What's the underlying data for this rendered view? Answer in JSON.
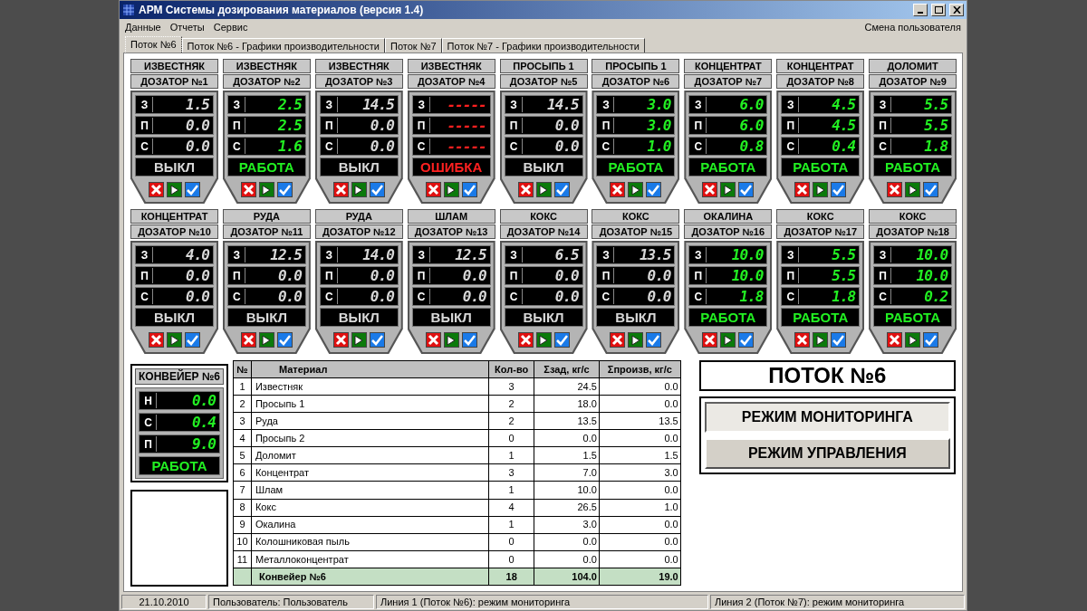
{
  "window": {
    "title": "АРМ Системы дозирования материалов (версия 1.4)"
  },
  "menu": [
    "Данные",
    "Отчеты",
    "Сервис"
  ],
  "user_switch": "Смена пользователя",
  "tabs": [
    {
      "label": "Поток №6",
      "selected": true
    },
    {
      "label": "Поток №6 - Графики производительности",
      "selected": false
    },
    {
      "label": "Поток №7",
      "selected": false
    },
    {
      "label": "Поток №7 - Графики производительности",
      "selected": false
    }
  ],
  "dosers": [
    {
      "material": "ИЗВЕСТНЯК",
      "title": "ДОЗАТОР №1",
      "readings": [
        {
          "label": "З",
          "value": "1.5"
        },
        {
          "label": "П",
          "value": "0.0"
        },
        {
          "label": "С",
          "value": "0.0"
        }
      ],
      "status": {
        "kind": "off",
        "text": "ВЫКЛ"
      }
    },
    {
      "material": "ИЗВЕСТНЯК",
      "title": "ДОЗАТОР №2",
      "readings": [
        {
          "label": "З",
          "value": "2.5"
        },
        {
          "label": "П",
          "value": "2.5"
        },
        {
          "label": "С",
          "value": "1.6"
        }
      ],
      "status": {
        "kind": "run",
        "text": "РАБОТА"
      }
    },
    {
      "material": "ИЗВЕСТНЯК",
      "title": "ДОЗАТОР №3",
      "readings": [
        {
          "label": "З",
          "value": "14.5"
        },
        {
          "label": "П",
          "value": "0.0"
        },
        {
          "label": "С",
          "value": "0.0"
        }
      ],
      "status": {
        "kind": "off",
        "text": "ВЫКЛ"
      }
    },
    {
      "material": "ИЗВЕСТНЯК",
      "title": "ДОЗАТОР №4",
      "readings": [
        {
          "label": "З",
          "value": "-----"
        },
        {
          "label": "П",
          "value": "-----"
        },
        {
          "label": "С",
          "value": "-----"
        }
      ],
      "status": {
        "kind": "error",
        "text": "ОШИБКА"
      }
    },
    {
      "material": "ПРОСЫПЬ 1",
      "title": "ДОЗАТОР №5",
      "readings": [
        {
          "label": "З",
          "value": "14.5"
        },
        {
          "label": "П",
          "value": "0.0"
        },
        {
          "label": "С",
          "value": "0.0"
        }
      ],
      "status": {
        "kind": "off",
        "text": "ВЫКЛ"
      }
    },
    {
      "material": "ПРОСЫПЬ 1",
      "title": "ДОЗАТОР №6",
      "readings": [
        {
          "label": "З",
          "value": "3.0"
        },
        {
          "label": "П",
          "value": "3.0"
        },
        {
          "label": "С",
          "value": "1.0"
        }
      ],
      "status": {
        "kind": "run",
        "text": "РАБОТА"
      }
    },
    {
      "material": "КОНЦЕНТРАТ",
      "title": "ДОЗАТОР №7",
      "readings": [
        {
          "label": "З",
          "value": "6.0"
        },
        {
          "label": "П",
          "value": "6.0"
        },
        {
          "label": "С",
          "value": "0.8"
        }
      ],
      "status": {
        "kind": "run",
        "text": "РАБОТА"
      }
    },
    {
      "material": "КОНЦЕНТРАТ",
      "title": "ДОЗАТОР №8",
      "readings": [
        {
          "label": "З",
          "value": "4.5"
        },
        {
          "label": "П",
          "value": "4.5"
        },
        {
          "label": "С",
          "value": "0.4"
        }
      ],
      "status": {
        "kind": "run",
        "text": "РАБОТА"
      }
    },
    {
      "material": "ДОЛОМИТ",
      "title": "ДОЗАТОР №9",
      "readings": [
        {
          "label": "З",
          "value": "5.5"
        },
        {
          "label": "П",
          "value": "5.5"
        },
        {
          "label": "С",
          "value": "1.8"
        }
      ],
      "status": {
        "kind": "run",
        "text": "РАБОТА"
      }
    },
    {
      "material": "КОНЦЕНТРАТ",
      "title": "ДОЗАТОР №10",
      "readings": [
        {
          "label": "З",
          "value": "4.0"
        },
        {
          "label": "П",
          "value": "0.0"
        },
        {
          "label": "С",
          "value": "0.0"
        }
      ],
      "status": {
        "kind": "off",
        "text": "ВЫКЛ"
      }
    },
    {
      "material": "РУДА",
      "title": "ДОЗАТОР №11",
      "readings": [
        {
          "label": "З",
          "value": "12.5"
        },
        {
          "label": "П",
          "value": "0.0"
        },
        {
          "label": "С",
          "value": "0.0"
        }
      ],
      "status": {
        "kind": "off",
        "text": "ВЫКЛ"
      }
    },
    {
      "material": "РУДА",
      "title": "ДОЗАТОР №12",
      "readings": [
        {
          "label": "З",
          "value": "14.0"
        },
        {
          "label": "П",
          "value": "0.0"
        },
        {
          "label": "С",
          "value": "0.0"
        }
      ],
      "status": {
        "kind": "off",
        "text": "ВЫКЛ"
      }
    },
    {
      "material": "ШЛАМ",
      "title": "ДОЗАТОР №13",
      "readings": [
        {
          "label": "З",
          "value": "12.5"
        },
        {
          "label": "П",
          "value": "0.0"
        },
        {
          "label": "С",
          "value": "0.0"
        }
      ],
      "status": {
        "kind": "off",
        "text": "ВЫКЛ"
      }
    },
    {
      "material": "КОКС",
      "title": "ДОЗАТОР №14",
      "readings": [
        {
          "label": "З",
          "value": "6.5"
        },
        {
          "label": "П",
          "value": "0.0"
        },
        {
          "label": "С",
          "value": "0.0"
        }
      ],
      "status": {
        "kind": "off",
        "text": "ВЫКЛ"
      }
    },
    {
      "material": "КОКС",
      "title": "ДОЗАТОР №15",
      "readings": [
        {
          "label": "З",
          "value": "13.5"
        },
        {
          "label": "П",
          "value": "0.0"
        },
        {
          "label": "С",
          "value": "0.0"
        }
      ],
      "status": {
        "kind": "off",
        "text": "ВЫКЛ"
      }
    },
    {
      "material": "ОКАЛИНА",
      "title": "ДОЗАТОР №16",
      "readings": [
        {
          "label": "З",
          "value": "10.0"
        },
        {
          "label": "П",
          "value": "10.0"
        },
        {
          "label": "С",
          "value": "1.8"
        }
      ],
      "status": {
        "kind": "run",
        "text": "РАБОТА"
      }
    },
    {
      "material": "КОКС",
      "title": "ДОЗАТОР №17",
      "readings": [
        {
          "label": "З",
          "value": "5.5"
        },
        {
          "label": "П",
          "value": "5.5"
        },
        {
          "label": "С",
          "value": "1.8"
        }
      ],
      "status": {
        "kind": "run",
        "text": "РАБОТА"
      }
    },
    {
      "material": "КОКС",
      "title": "ДОЗАТОР №18",
      "readings": [
        {
          "label": "З",
          "value": "10.0"
        },
        {
          "label": "П",
          "value": "10.0"
        },
        {
          "label": "С",
          "value": "0.2"
        }
      ],
      "status": {
        "kind": "run",
        "text": "РАБОТА"
      }
    }
  ],
  "conveyor": {
    "title": "КОНВЕЙЕР №6",
    "readings": [
      {
        "label": "Н",
        "value": "0.0"
      },
      {
        "label": "С",
        "value": "0.4"
      },
      {
        "label": "П",
        "value": "9.0"
      }
    ],
    "status": {
      "kind": "run",
      "text": "РАБОТА"
    }
  },
  "table": {
    "columns": [
      "№",
      "Материал",
      "Кол-во",
      "Σзад, кг/с",
      "Σпроизв, кг/с"
    ],
    "rows": [
      [
        "1",
        "Известняк",
        "3",
        "24.5",
        "0.0"
      ],
      [
        "2",
        "Просыпь 1",
        "2",
        "18.0",
        "0.0"
      ],
      [
        "3",
        "Руда",
        "2",
        "13.5",
        "13.5"
      ],
      [
        "4",
        "Просыпь 2",
        "0",
        "0.0",
        "0.0"
      ],
      [
        "5",
        "Доломит",
        "1",
        "1.5",
        "1.5"
      ],
      [
        "6",
        "Концентрат",
        "3",
        "7.0",
        "3.0"
      ],
      [
        "7",
        "Шлам",
        "1",
        "10.0",
        "0.0"
      ],
      [
        "8",
        "Кокс",
        "4",
        "26.5",
        "1.0"
      ],
      [
        "9",
        "Окалина",
        "1",
        "3.0",
        "0.0"
      ],
      [
        "10",
        "Колошниковая пыль",
        "0",
        "0.0",
        "0.0"
      ],
      [
        "11",
        "Металлоконцентрат",
        "0",
        "0.0",
        "0.0"
      ]
    ],
    "total": {
      "label": "Конвейер №6",
      "count": "18",
      "set": "104.0",
      "actual": "19.0"
    }
  },
  "flow_title": "ПОТОК №6",
  "modes": [
    {
      "label": "РЕЖИМ МОНИТОРИНГА",
      "selected": true
    },
    {
      "label": "РЕЖИМ УПРАВЛЕНИЯ",
      "selected": false
    }
  ],
  "status_bar": [
    "21.10.2010",
    "Пользователь: Пользователь",
    "Линия 1 (Поток №6): режим мониторинга",
    "Линия 2 (Поток №7): режим мониторинга"
  ]
}
